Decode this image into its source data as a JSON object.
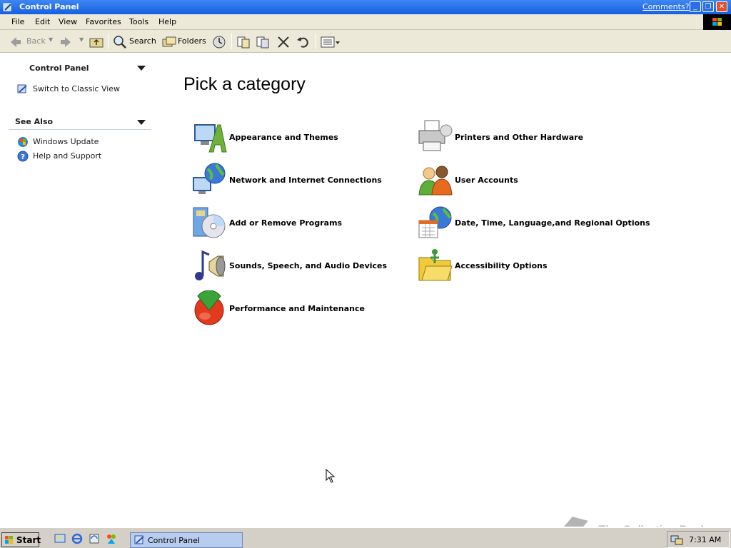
{
  "window": {
    "title": "Control Panel",
    "comments_link": "Comments?",
    "controls": {
      "minimize": "_",
      "restore": "❐",
      "close": "✕"
    }
  },
  "menubar": {
    "items": [
      "File",
      "Edit",
      "View",
      "Favorites",
      "Tools",
      "Help"
    ]
  },
  "toolbar": {
    "back": "Back",
    "search": "Search",
    "folders": "Folders"
  },
  "sidebar": {
    "panel_title": "Control Panel",
    "switch_view": "Switch to Classic View",
    "see_also_title": "See Also",
    "see_also": [
      "Windows Update",
      "Help and Support"
    ]
  },
  "main": {
    "heading": "Pick a category",
    "categories": [
      {
        "label": "Appearance and Themes",
        "icon": "appearance-icon"
      },
      {
        "label": "Printers and Other Hardware",
        "icon": "printer-icon"
      },
      {
        "label": "Network and Internet Connections",
        "icon": "network-icon"
      },
      {
        "label": "User Accounts",
        "icon": "users-icon"
      },
      {
        "label": "Add or Remove Programs",
        "icon": "programs-icon"
      },
      {
        "label": "Date, Time, Language,and Regional Options",
        "icon": "calendar-globe-icon"
      },
      {
        "label": "Sounds, Speech, and Audio Devices",
        "icon": "speaker-icon"
      },
      {
        "label": "Accessibility Options",
        "icon": "accessibility-icon"
      },
      {
        "label": "Performance and Maintenance",
        "icon": "performance-icon"
      }
    ]
  },
  "taskbar": {
    "start": "Start",
    "task": "Control Panel",
    "clock": "7:31 AM"
  },
  "watermark": "The Collection Book",
  "colors": {
    "titlebar": "#1660e0",
    "link": "#215dc6",
    "taskbar": "#d4d0c8"
  }
}
